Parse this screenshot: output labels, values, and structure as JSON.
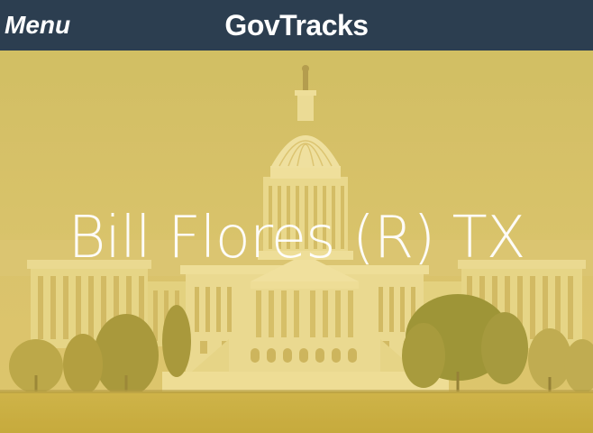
{
  "navbar": {
    "menu_label": "Menu",
    "brand": "GovTracks"
  },
  "hero": {
    "title": "Bill Flores (R) TX",
    "image_icon": "capitol-building-image",
    "overlay_color": "#e8c94a"
  },
  "colors": {
    "navbar_bg": "#2c3e50",
    "nav_text": "#ffffff",
    "overlay": "#e8c94a"
  }
}
